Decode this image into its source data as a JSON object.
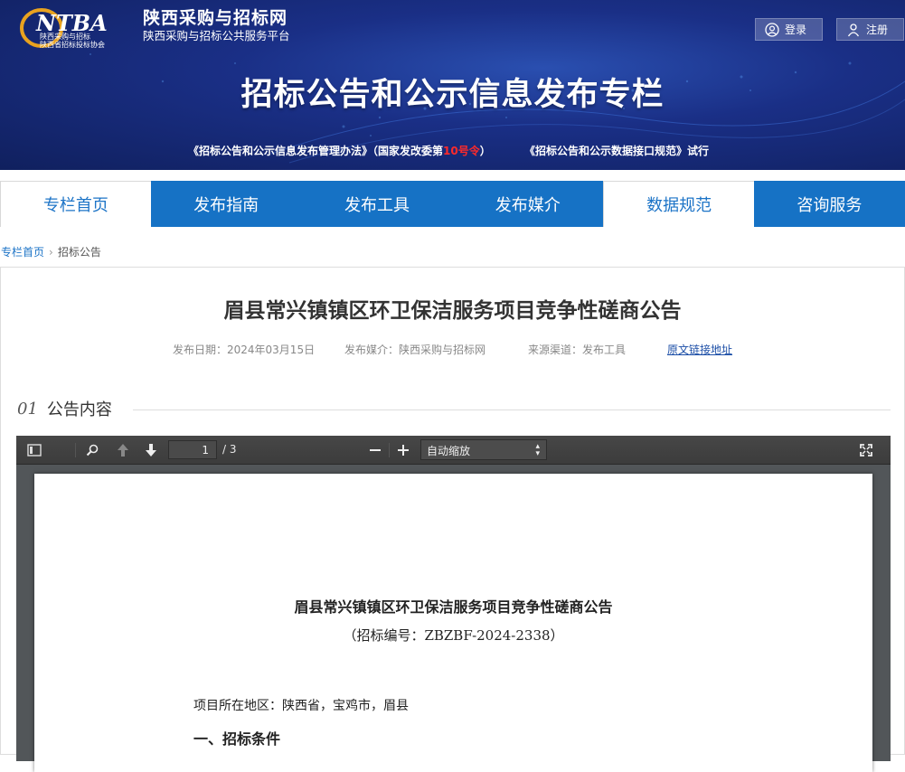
{
  "header": {
    "logo_title": "陕西采购与招标网",
    "logo_subtitle": "陕西采购与招标公共服务平台",
    "login_label": "登录",
    "register_label": "注册",
    "banner_title": "招标公告和公示信息发布专栏",
    "link1_prefix": "《招标公告和公示信息发布管理办法》（国家发改委第",
    "link1_highlight": "10号令",
    "link1_suffix": "）",
    "link2": "《招标公告和公示数据接口规范》试行"
  },
  "nav": {
    "tabs": [
      {
        "label": "专栏首页"
      },
      {
        "label": "发布指南"
      },
      {
        "label": "发布工具"
      },
      {
        "label": "发布媒介"
      },
      {
        "label": "数据规范"
      },
      {
        "label": "咨询服务"
      }
    ]
  },
  "breadcrumb": {
    "home": "专栏首页",
    "current": "招标公告"
  },
  "article": {
    "title": "眉县常兴镇镇区环卫保洁服务项目竞争性磋商公告",
    "publish_date": "发布日期：2024年03月15日",
    "media": "发布媒介：陕西采购与招标网",
    "source": "来源渠道：发布工具",
    "original_link": "原文链接地址",
    "section_num": "01",
    "section_label": "公告内容"
  },
  "viewer": {
    "page_current": "1",
    "page_total": "/ 3",
    "zoom_value": "自动缩放"
  },
  "document": {
    "title": "眉县常兴镇镇区环卫保洁服务项目竞争性磋商公告",
    "number": "（招标编号：ZBZBF-2024-2338）",
    "location": "项目所在地区：陕西省，宝鸡市，眉县",
    "section1": "一、招标条件"
  },
  "colors": {
    "accent": "#1672c5",
    "banner": "#1a2f86",
    "highlight": "#ff2a2a"
  }
}
